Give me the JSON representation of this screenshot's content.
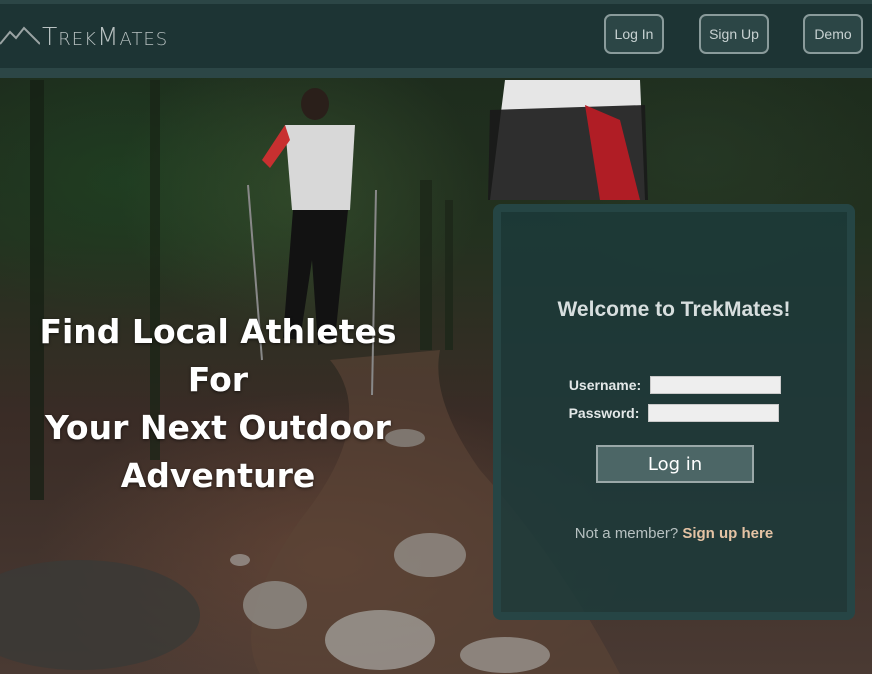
{
  "brand": {
    "name": "TrekMates",
    "icon": "mountain-icon"
  },
  "nav": {
    "login_label": "Log In",
    "signup_label": "Sign Up",
    "demo_label": "Demo"
  },
  "hero": {
    "headline_line1": "Find Local Athletes For",
    "headline_line2": "Your Next Outdoor",
    "headline_line3": "Adventure"
  },
  "login_form": {
    "title": "Welcome to TrekMates!",
    "username_label": "Username:",
    "username_value": "",
    "password_label": "Password:",
    "password_value": "",
    "submit_label": "Log in",
    "member_prompt": "Not a member?",
    "signup_link": "Sign up here"
  },
  "colors": {
    "nav_bg": "#1d3434",
    "nav_border": "#2c4646",
    "panel_bg": "#1c3a3a",
    "link_accent": "#e5c3a4",
    "button_bg": "#4c6666"
  }
}
